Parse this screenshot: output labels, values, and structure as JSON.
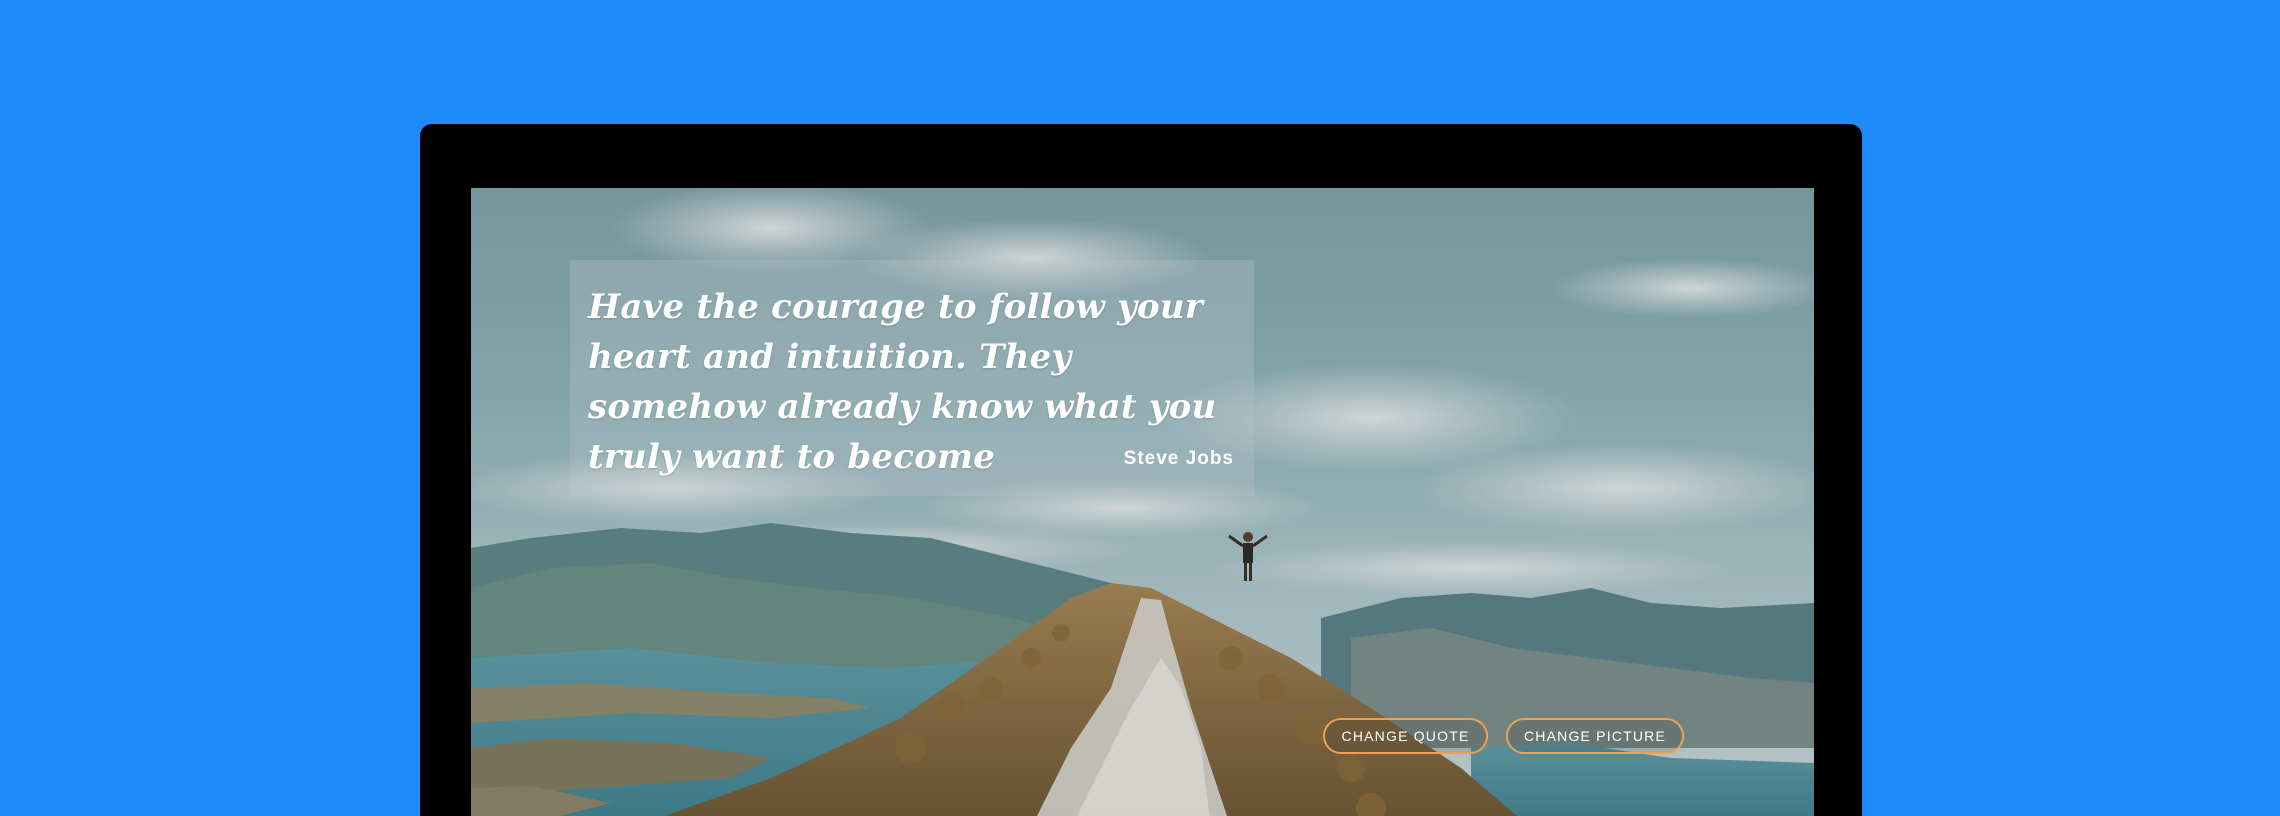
{
  "quote": {
    "text": "Have the courage to follow your heart and intuition. They somehow already know what you truly want to become",
    "author": "Steve Jobs"
  },
  "buttons": {
    "change_quote": "CHANGE QUOTE",
    "change_picture": "CHANGE PICTURE"
  },
  "colors": {
    "background": "#1f8bfb",
    "monitor_bezel": "#000000",
    "button_border": "#f0a052",
    "text": "#ffffff"
  }
}
